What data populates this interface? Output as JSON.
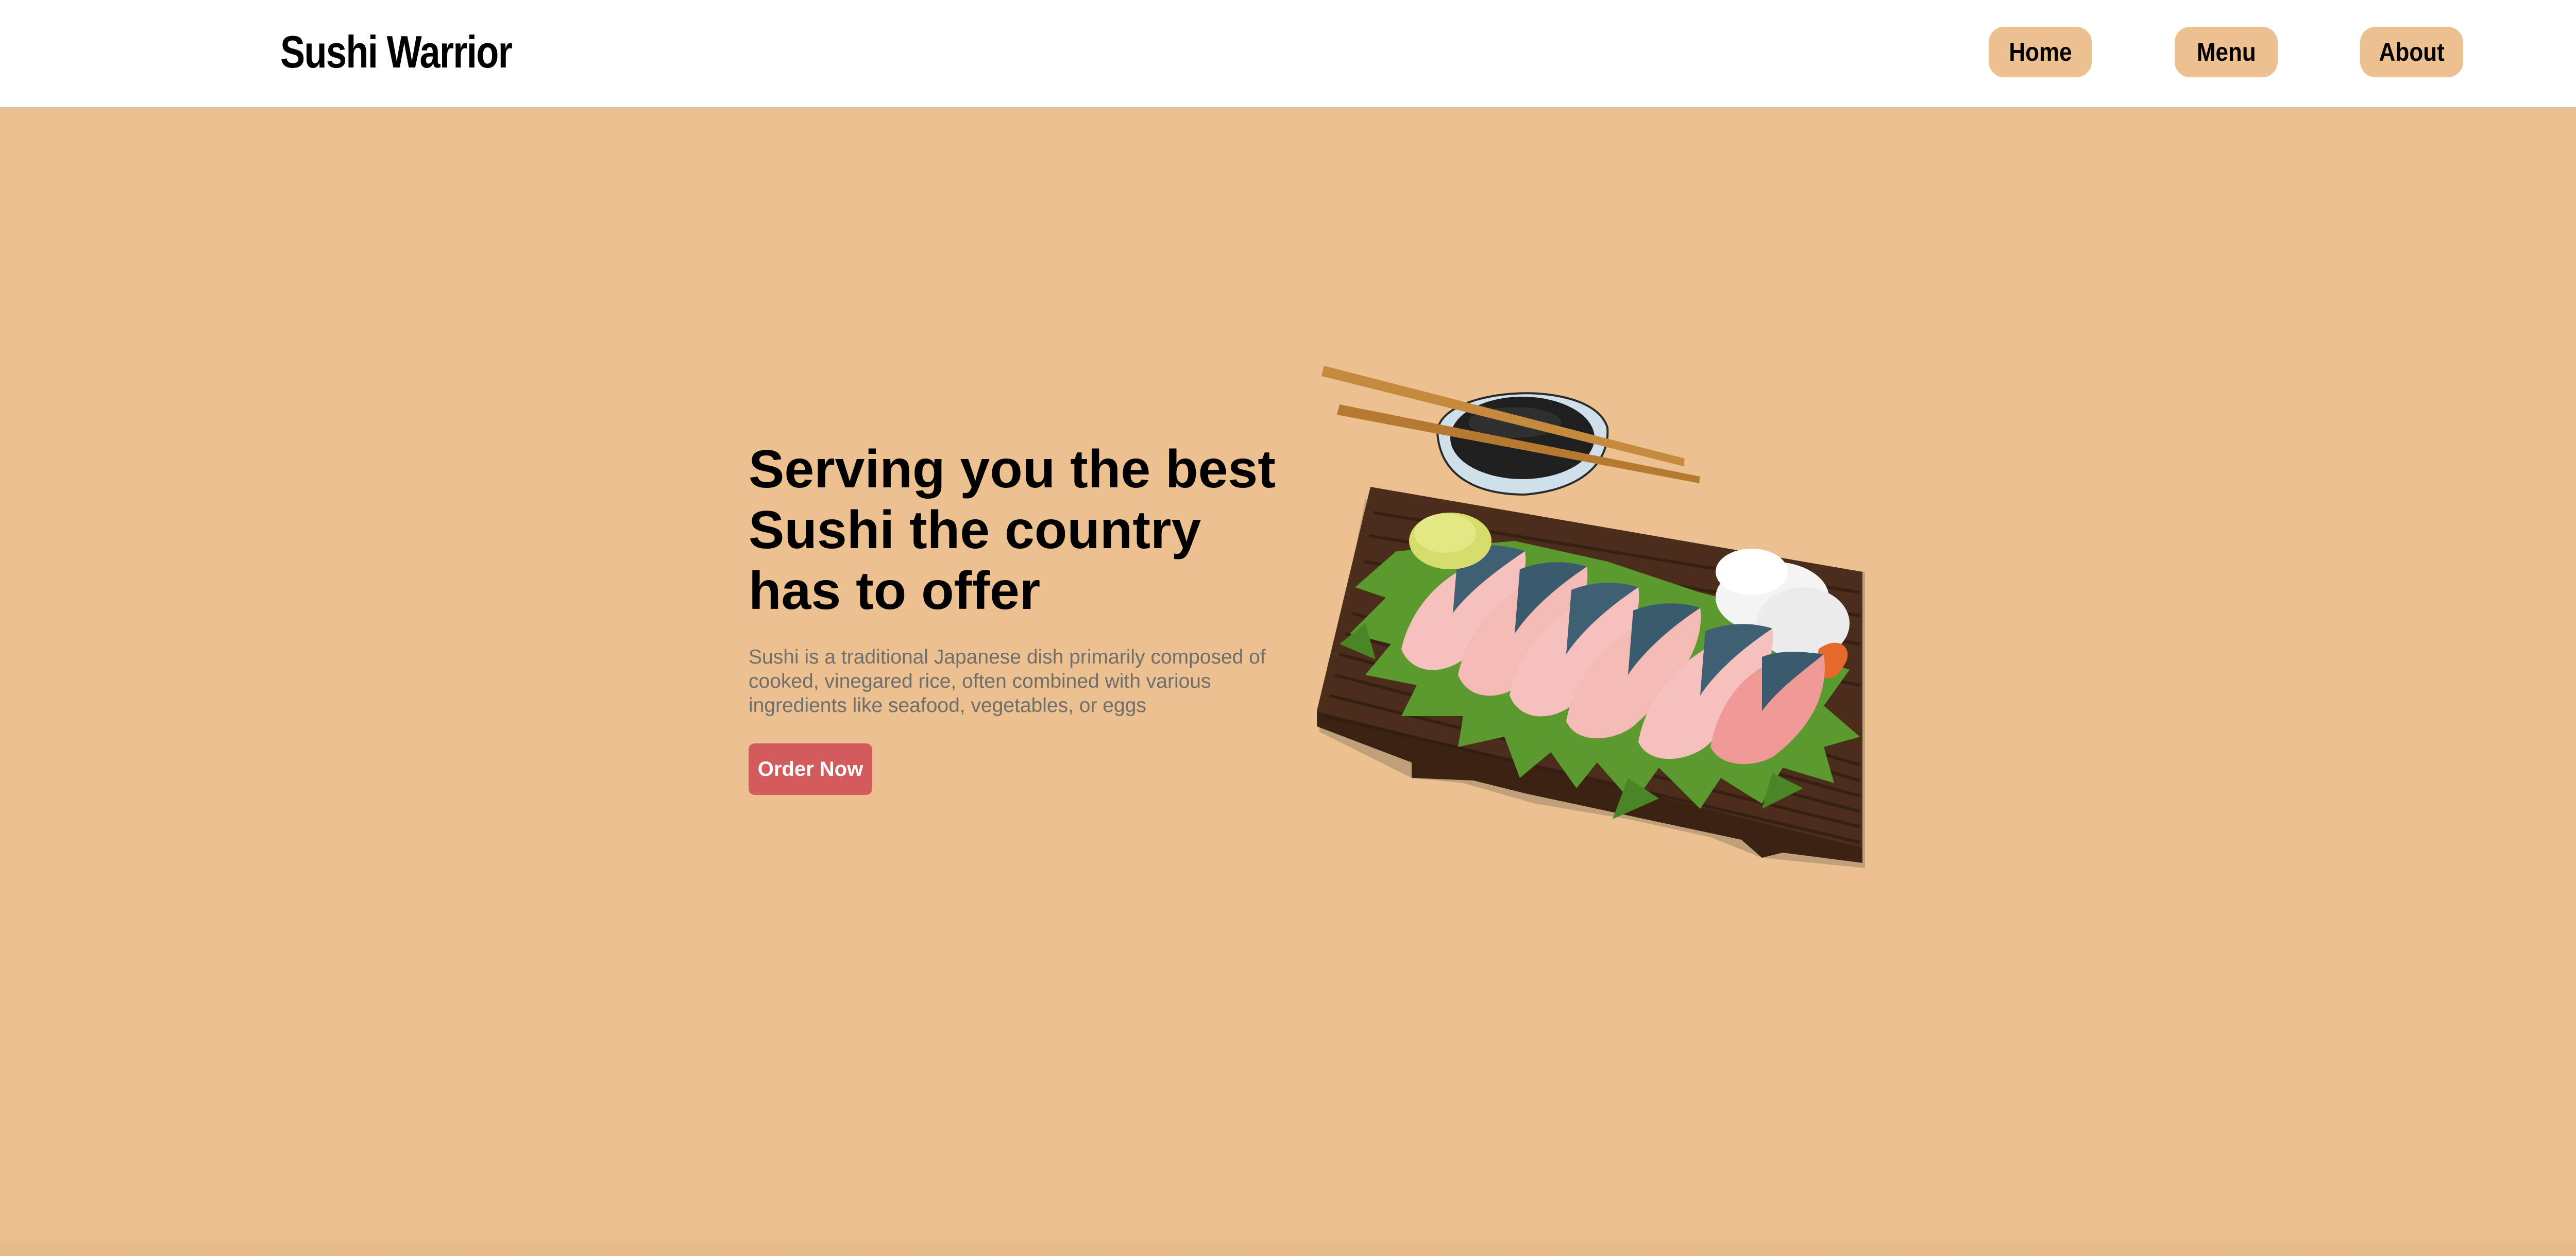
{
  "header": {
    "brand": "Sushi Warrior",
    "nav": [
      {
        "label": "Home"
      },
      {
        "label": "Menu"
      },
      {
        "label": "About"
      }
    ]
  },
  "hero": {
    "headline": "Serving you the best Sushi the country has to offer",
    "description": "Sushi is a traditional Japanese dish primarily composed of cooked, vinegared rice, often combined with various ingredients like seafood, vegetables, or eggs",
    "cta_label": "Order Now"
  },
  "colors": {
    "background": "#ecc08f",
    "header_bg": "#ffffff",
    "nav_button": "#ecc08f",
    "cta": "#d35b5b",
    "description_text": "#6e6e6e"
  },
  "icons": {
    "hero_image": "sashimi-platter-illustration"
  }
}
